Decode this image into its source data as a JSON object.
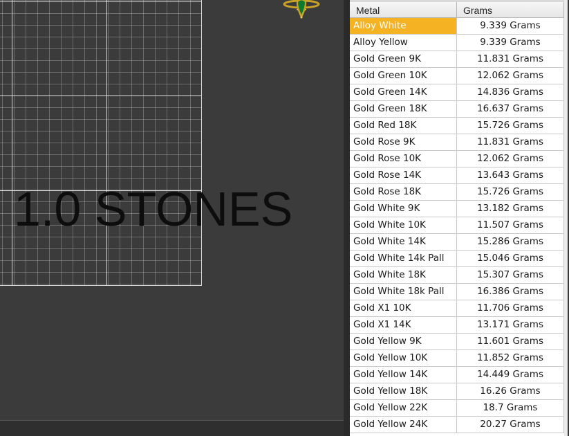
{
  "viewport": {
    "overlay_text": "1.0 STONES",
    "ring_icon": "ring-emerald-icon"
  },
  "table": {
    "headers": {
      "metal": "Metal",
      "grams": "Grams"
    },
    "selected_index": 0,
    "selection_color": "#f5b223",
    "rows": [
      {
        "metal": "Alloy White",
        "grams": "9.339 Grams"
      },
      {
        "metal": "Alloy Yellow",
        "grams": "9.339 Grams"
      },
      {
        "metal": "Gold Green 9K",
        "grams": "11.831 Grams"
      },
      {
        "metal": "Gold Green 10K",
        "grams": "12.062 Grams"
      },
      {
        "metal": "Gold Green 14K",
        "grams": "14.836 Grams"
      },
      {
        "metal": "Gold Green 18K",
        "grams": "16.637 Grams"
      },
      {
        "metal": "Gold Red 18K",
        "grams": "15.726 Grams"
      },
      {
        "metal": "Gold Rose 9K",
        "grams": "11.831 Grams"
      },
      {
        "metal": "Gold Rose 10K",
        "grams": "12.062 Grams"
      },
      {
        "metal": "Gold Rose 14K",
        "grams": "13.643 Grams"
      },
      {
        "metal": "Gold Rose 18K",
        "grams": "15.726 Grams"
      },
      {
        "metal": "Gold White 9K",
        "grams": "13.182 Grams"
      },
      {
        "metal": "Gold White 10K",
        "grams": "11.507 Grams"
      },
      {
        "metal": "Gold White 14K",
        "grams": "15.286 Grams"
      },
      {
        "metal": "Gold White 14k Pall",
        "grams": "15.046 Grams"
      },
      {
        "metal": "Gold White 18K",
        "grams": "15.307 Grams"
      },
      {
        "metal": "Gold White 18k Pall",
        "grams": "16.386 Grams"
      },
      {
        "metal": "Gold X1 10K",
        "grams": "11.706 Grams"
      },
      {
        "metal": "Gold X1 14K",
        "grams": "13.171 Grams"
      },
      {
        "metal": "Gold Yellow 9K",
        "grams": "11.601 Grams"
      },
      {
        "metal": "Gold Yellow 10K",
        "grams": "11.852 Grams"
      },
      {
        "metal": "Gold Yellow 14K",
        "grams": "14.449 Grams"
      },
      {
        "metal": "Gold Yellow 18K",
        "grams": "16.26 Grams"
      },
      {
        "metal": "Gold Yellow 22K",
        "grams": "18.7 Grams"
      },
      {
        "metal": "Gold Yellow 24K",
        "grams": "20.27 Grams"
      }
    ]
  }
}
